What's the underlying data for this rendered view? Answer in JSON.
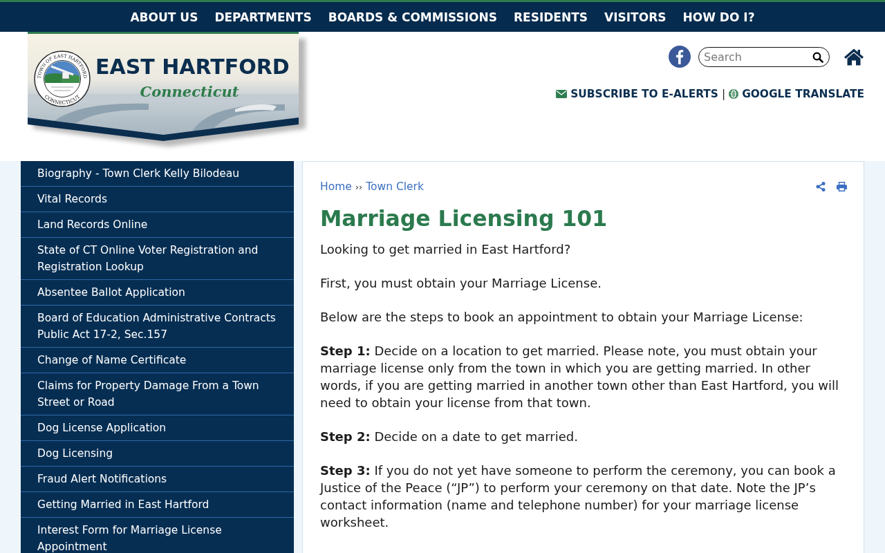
{
  "top_nav": {
    "items": [
      "ABOUT US",
      "DEPARTMENTS",
      "BOARDS & COMMISSIONS",
      "RESIDENTS",
      "VISITORS",
      "HOW DO I?"
    ]
  },
  "header": {
    "logo": {
      "seal_top": "TOWN OF EAST HARTFORD",
      "seal_bottom": "CONNECTICUT",
      "title": "EAST HARTFORD",
      "subtitle": "Connecticut"
    },
    "search": {
      "placeholder": "Search"
    },
    "links": [
      {
        "kind": "email",
        "label": "SUBSCRIBE TO E-ALERTS"
      },
      {
        "kind": "globe",
        "label": "GOOGLE TRANSLATE"
      }
    ],
    "link_separator": "|"
  },
  "sidebar": {
    "items": [
      "Biography - Town Clerk Kelly Bilodeau",
      "Vital Records",
      "Land Records Online",
      "State of CT Online Voter Registration and Registration Lookup",
      "Absentee Ballot Application",
      "Board of Education Administrative Contracts Public Act 17-2, Sec.157",
      "Change of Name Certificate",
      "Claims for Property Damage From a Town Street or Road",
      "Dog License Application",
      "Dog Licensing",
      "Fraud Alert Notifications",
      "Getting Married in East Hartford",
      "Interest Form for Marriage License Appointment"
    ]
  },
  "content": {
    "breadcrumb": {
      "items": [
        "Home",
        "Town Clerk"
      ],
      "separator": "››"
    },
    "title": "Marriage Licensing 101",
    "paragraphs": [
      "Looking to get married in East Hartford?",
      "First, you must obtain your Marriage License.",
      "Below are the steps to book an appointment to obtain your Marriage License:",
      "**Step 1:** Decide on a location to get married. Please note, you must obtain your marriage license only from the town in which you are getting married. In other words, if you are getting married in another town other than East Hartford, you will need to obtain your license from that town.",
      "**Step 2:** Decide on a date to get married.",
      "**Step 3:** If you do not yet have someone to perform the ceremony, you can book a Justice of the Peace (“JP”) to perform your ceremony on that date. Note the JP’s contact information (name and telephone number) for your marriage license worksheet."
    ]
  }
}
